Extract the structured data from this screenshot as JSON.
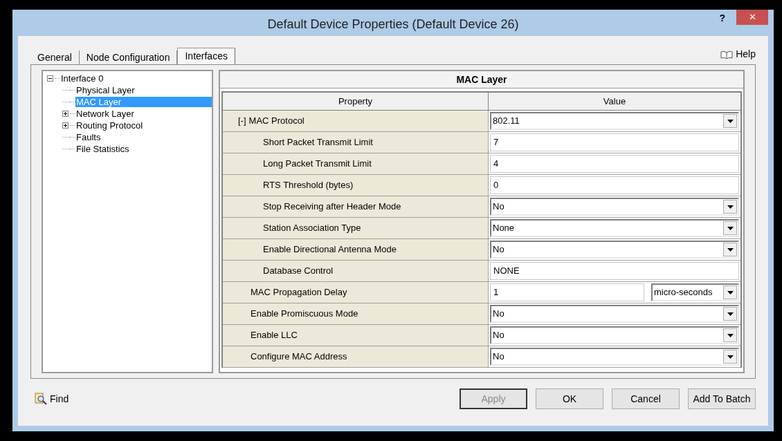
{
  "window": {
    "title": "Default Device Properties (Default Device 26)",
    "help_glyph": "?",
    "close_glyph": "✕"
  },
  "tabs": [
    {
      "label": "General",
      "selected": false
    },
    {
      "label": "Node Configuration",
      "selected": false
    },
    {
      "label": "Interfaces",
      "selected": true
    }
  ],
  "help_link": "Help",
  "tree": [
    {
      "kind": "branch",
      "label": "Interface 0",
      "expanded": true,
      "selected": false,
      "children": [
        {
          "kind": "leaf",
          "label": "Physical Layer",
          "selected": false
        },
        {
          "kind": "leaf",
          "label": "MAC Layer",
          "selected": true
        },
        {
          "kind": "branch",
          "label": "Network Layer",
          "expanded": false,
          "selected": false
        },
        {
          "kind": "branch",
          "label": "Routing Protocol",
          "expanded": false,
          "selected": false
        },
        {
          "kind": "leaf",
          "label": "Faults",
          "selected": false
        },
        {
          "kind": "leaf",
          "label": "File Statistics",
          "selected": false
        }
      ]
    }
  ],
  "panel": {
    "title": "MAC Layer",
    "columns": [
      "Property",
      "Value"
    ],
    "rows": [
      {
        "property": "MAC Protocol",
        "toggle": "[-]",
        "kind": "dropdown",
        "value": "802.11",
        "children": [
          {
            "property": "Short Packet Transmit Limit",
            "kind": "text",
            "value": "7"
          },
          {
            "property": "Long Packet Transmit Limit",
            "kind": "text",
            "value": "4"
          },
          {
            "property": "RTS Threshold (bytes)",
            "kind": "text",
            "value": "0"
          },
          {
            "property": "Stop Receiving after Header Mode",
            "kind": "dropdown",
            "value": "No"
          },
          {
            "property": "Station Association Type",
            "kind": "dropdown",
            "value": "None"
          },
          {
            "property": "Enable Directional Antenna Mode",
            "kind": "dropdown",
            "value": "No"
          },
          {
            "property": "Database Control",
            "kind": "text",
            "value": "NONE"
          }
        ]
      },
      {
        "property": "MAC Propagation Delay",
        "kind": "text_unit",
        "value": "1",
        "unit": "micro-seconds"
      },
      {
        "property": "Enable Promiscuous Mode",
        "kind": "dropdown",
        "value": "No"
      },
      {
        "property": "Enable LLC",
        "kind": "dropdown",
        "value": "No"
      },
      {
        "property": "Configure MAC Address",
        "kind": "dropdown",
        "value": "No"
      }
    ]
  },
  "find_link": "Find",
  "buttons": [
    {
      "label": "Apply",
      "disabled": true
    },
    {
      "label": "OK",
      "disabled": false
    },
    {
      "label": "Cancel",
      "disabled": false
    },
    {
      "label": "Add To Batch",
      "disabled": false
    }
  ]
}
